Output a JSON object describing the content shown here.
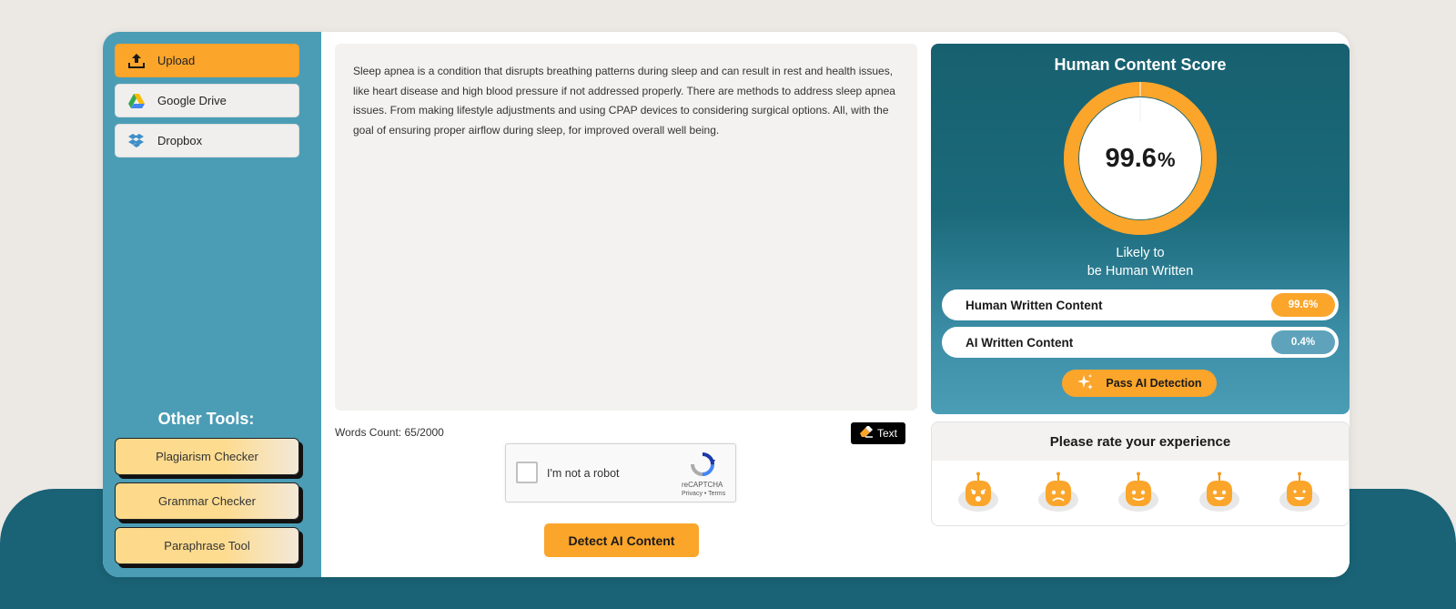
{
  "sidebar": {
    "upload_label": "Upload",
    "gdrive_label": "Google Drive",
    "dropbox_label": "Dropbox",
    "other_tools_title": "Other Tools:",
    "tools": [
      "Plagiarism Checker",
      "Grammar Checker",
      "Paraphrase Tool"
    ]
  },
  "editor": {
    "text": "Sleep apnea is a condition that disrupts breathing patterns during sleep and can result in rest and health issues, like heart disease and high blood pressure if not addressed properly. There are methods to address sleep apnea issues. From making lifestyle adjustments and using CPAP devices to considering surgical options. All, with the goal of ensuring proper airflow during sleep, for improved overall well being.",
    "words_count": "Words Count: 65/2000",
    "text_button": "Text"
  },
  "captcha": {
    "label": "I'm not a robot",
    "brand": "reCAPTCHA",
    "terms": "Privacy • Terms"
  },
  "detect_button": "Detect AI Content",
  "score": {
    "title": "Human Content Score",
    "value": "99.6",
    "unit": "%",
    "fraction": 0.996,
    "verdict_line1": "Likely to",
    "verdict_line2": "be Human Written",
    "human_label": "Human Written Content",
    "human_value": "99.6%",
    "ai_label": "AI Written Content",
    "ai_value": "0.4%",
    "pass_button": "Pass AI Detection"
  },
  "rating": {
    "title": "Please rate your experience",
    "faces": [
      "angry-face-icon",
      "sad-face-icon",
      "neutral-face-icon",
      "happy-face-icon",
      "love-face-icon"
    ]
  },
  "colors": {
    "accent": "#fba52b",
    "sidebar": "#4b9db5",
    "panel_dark": "#17606f"
  }
}
